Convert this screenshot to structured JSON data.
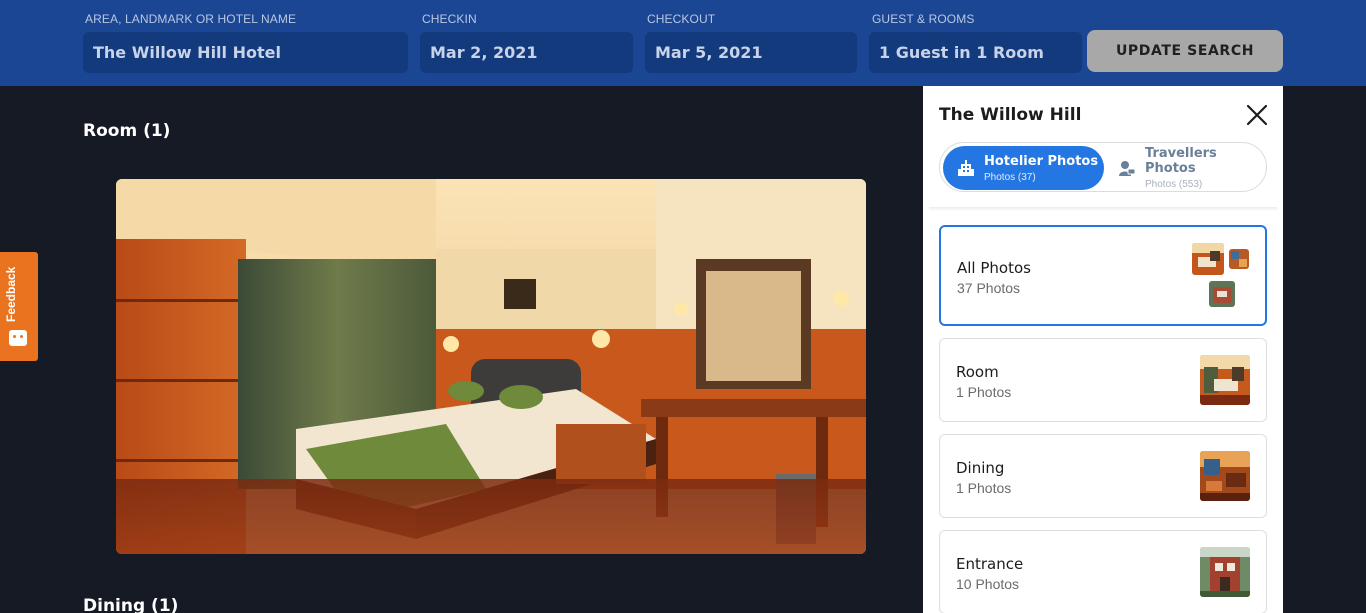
{
  "search": {
    "location_label": "AREA, LANDMARK OR HOTEL NAME",
    "location_value": "The Willow Hill Hotel",
    "checkin_label": "CHECKIN",
    "checkin_value": "Mar 2, 2021",
    "checkout_label": "CHECKOUT",
    "checkout_value": "Mar 5, 2021",
    "guests_label": "GUEST & ROOMS",
    "guests_value": "1 Guest in 1 Room",
    "update_label": "UPDATE SEARCH"
  },
  "main": {
    "sections": [
      {
        "title": "Room (1)"
      },
      {
        "title": "Dining (1)"
      }
    ]
  },
  "feedback": {
    "label": "Feedback"
  },
  "panel": {
    "title": "The Willow Hill",
    "tabs": [
      {
        "label": "Hotelier Photos",
        "sub": "Photos (37)",
        "icon": "hotel-building-icon",
        "active": true
      },
      {
        "label": "Travellers Photos",
        "sub": "Photos (553)",
        "icon": "traveller-camera-icon",
        "active": false
      }
    ],
    "categories": [
      {
        "title": "All Photos",
        "count": "37 Photos",
        "selected": true
      },
      {
        "title": "Room",
        "count": "1 Photos",
        "selected": false
      },
      {
        "title": "Dining",
        "count": "1 Photos",
        "selected": false
      },
      {
        "title": "Entrance",
        "count": "10 Photos",
        "selected": false
      }
    ]
  },
  "colors": {
    "header_bg": "#1a4694",
    "page_bg": "#151a25",
    "accent": "#2477e2",
    "feedback": "#e9731f",
    "update_button": "#a8a8a8"
  }
}
